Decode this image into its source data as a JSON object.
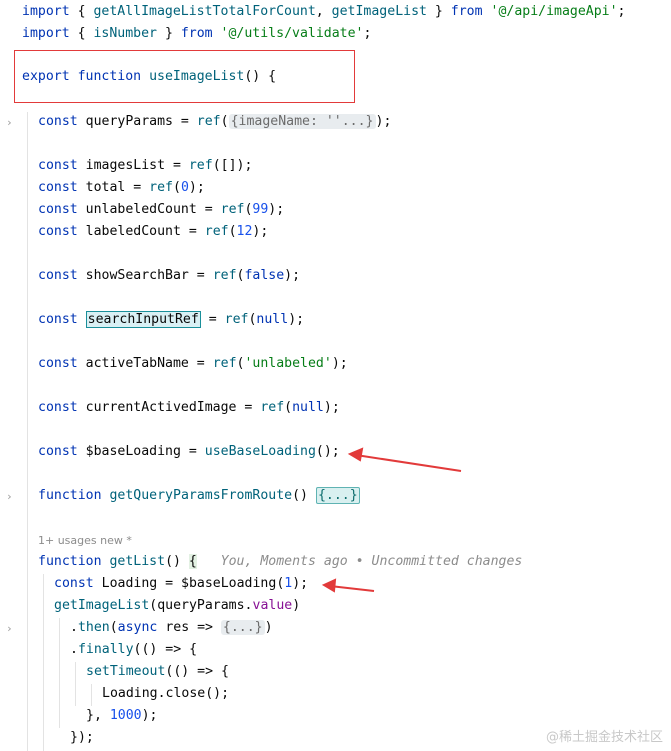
{
  "lines": {
    "import1": {
      "kw_import": "import",
      "open": " { ",
      "fn1": "getAllImageListTotalForCount",
      "comma": ", ",
      "fn2": "getImageList",
      "close": " } ",
      "kw_from": "from",
      "space": " ",
      "path": "'@/api/imageApi'",
      "semi": ";"
    },
    "import2": {
      "kw_import": "import",
      "open": " { ",
      "fn1": "isNumber",
      "close": " } ",
      "kw_from": "from",
      "space": " ",
      "path": "'@/utils/validate'",
      "semi": ";"
    },
    "export": {
      "kw_export": "export",
      "kw_function": "function",
      "name": "useImageList",
      "tail": "() {"
    },
    "queryParams": {
      "kw": "const",
      "name": " queryParams = ",
      "fn": "ref",
      "open": "(",
      "fold": "{imageName: ''...}",
      "close": ");"
    },
    "imagesList": {
      "kw": "const",
      "name": " imagesList = ",
      "fn": "ref",
      "args": "([]);"
    },
    "total": {
      "kw": "const",
      "name": " total = ",
      "fn": "ref",
      "open": "(",
      "num": "0",
      "close": ");"
    },
    "unlabeledCount": {
      "kw": "const",
      "name": " unlabeledCount = ",
      "fn": "ref",
      "open": "(",
      "num": "99",
      "close": ");"
    },
    "labeledCount": {
      "kw": "const",
      "name": " labeledCount = ",
      "fn": "ref",
      "open": "(",
      "num": "12",
      "close": ");"
    },
    "showSearchBar": {
      "kw": "const",
      "name": " showSearchBar = ",
      "fn": "ref",
      "open": "(",
      "val": "false",
      "close": ");"
    },
    "searchInputRef": {
      "kw": "const",
      "space": " ",
      "name": "searchInputRef",
      "eq": " = ",
      "fn": "ref",
      "open": "(",
      "val": "null",
      "close": ");"
    },
    "activeTabName": {
      "kw": "const",
      "name": " activeTabName = ",
      "fn": "ref",
      "open": "(",
      "str": "'unlabeled'",
      "close": ");"
    },
    "currentActivedImage": {
      "kw": "const",
      "name": " currentActivedImage = ",
      "fn": "ref",
      "open": "(",
      "val": "null",
      "close": ");"
    },
    "baseLoading": {
      "kw": "const",
      "name": " $baseLoading = ",
      "fn": "useBaseLoading",
      "close": "();"
    },
    "getQueryParams": {
      "kw": "function",
      "space": " ",
      "name": "getQueryParamsFromRoute",
      "paren": "() ",
      "fold": "{...}"
    },
    "usage": {
      "text": "1+ usages   new *"
    },
    "getList": {
      "kw": "function",
      "space": " ",
      "name": "getList",
      "paren": "() ",
      "brace": "{",
      "inlay": "   You, Moments ago • Uncommitted changes"
    },
    "loading": {
      "kw": "const",
      "name": " Loading = $baseLoading(",
      "num": "1",
      "close": ");"
    },
    "callImageList": {
      "fn": "getImageList",
      "open": "(queryParams.",
      "prop": "value",
      "close": ")"
    },
    "then": {
      "dot": ".",
      "fn": "then",
      "open": "(",
      "kw": "async",
      "mid": " res => ",
      "fold": "{...}",
      "close": ")"
    },
    "finally": {
      "dot": ".",
      "fn": "finally",
      "tail": "(() => {"
    },
    "setTimeout": {
      "fn": "setTimeout",
      "tail": "(() => {"
    },
    "close": {
      "text": "Loading.close();"
    },
    "timeoutEnd": {
      "open": "}, ",
      "num": "1000",
      "close": ");"
    },
    "finallyEnd": {
      "text": "});"
    }
  },
  "watermark": "@稀土掘金技术社区",
  "colors": {
    "keyword": "#0033b3",
    "function": "#00627a",
    "string": "#067d17",
    "number": "#1750eb",
    "annotation_red": "#e23a3a"
  }
}
